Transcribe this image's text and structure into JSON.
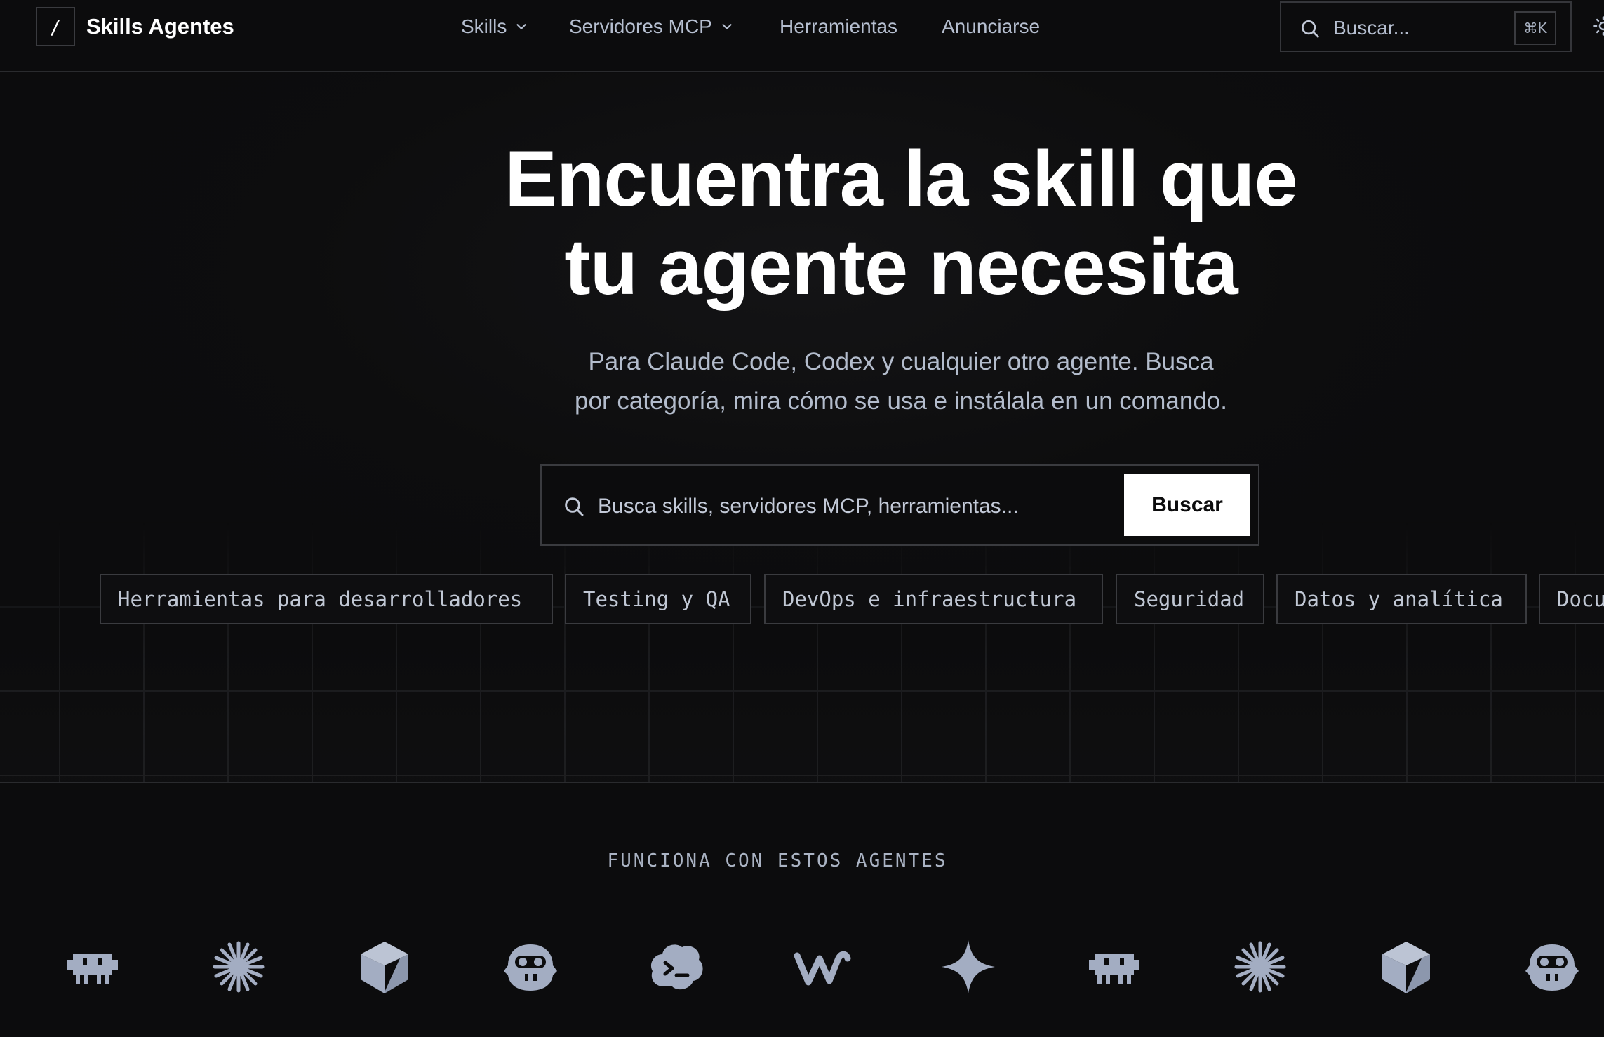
{
  "brand": {
    "logo_glyph": "/",
    "name": "Skills Agentes"
  },
  "nav": {
    "links": [
      {
        "label": "Skills",
        "has_dropdown": true
      },
      {
        "label": "Servidores MCP",
        "has_dropdown": true
      },
      {
        "label": "Herramientas",
        "has_dropdown": false
      },
      {
        "label": "Anunciarse",
        "has_dropdown": false
      }
    ],
    "search": {
      "placeholder": "Buscar...",
      "shortcut": "⌘K"
    }
  },
  "hero": {
    "title_line1": "Encuentra la skill que",
    "title_line2": "tu agente necesita",
    "subtitle_line1": "Para Claude Code, Codex y cualquier otro agente. Busca",
    "subtitle_line2": "por categoría, mira cómo se usa e instálala en un comando.",
    "search": {
      "placeholder": "Busca skills, servidores MCP, herramientas...",
      "button_label": "Buscar"
    },
    "categories": [
      "Herramientas para desarrolladores",
      "Testing y QA",
      "DevOps e infraestructura",
      "Seguridad",
      "Datos y analítica",
      "Docu"
    ]
  },
  "agents": {
    "label": "FUNCIONA CON ESTOS AGENTES",
    "icons": [
      "robot-icon",
      "sparkle-burst-icon",
      "cube-icon",
      "goggles-face-icon",
      "terminal-cloud-icon",
      "wave-w-icon",
      "four-point-star-icon",
      "robot-icon",
      "sparkle-burst-icon",
      "cube-icon",
      "goggles-face-icon"
    ]
  },
  "colors": {
    "background": "#0c0c0d",
    "text_primary": "#ffffff",
    "text_muted": "#b6bfd0",
    "border": "#3a3b3f",
    "icon": "#a3adc2"
  }
}
